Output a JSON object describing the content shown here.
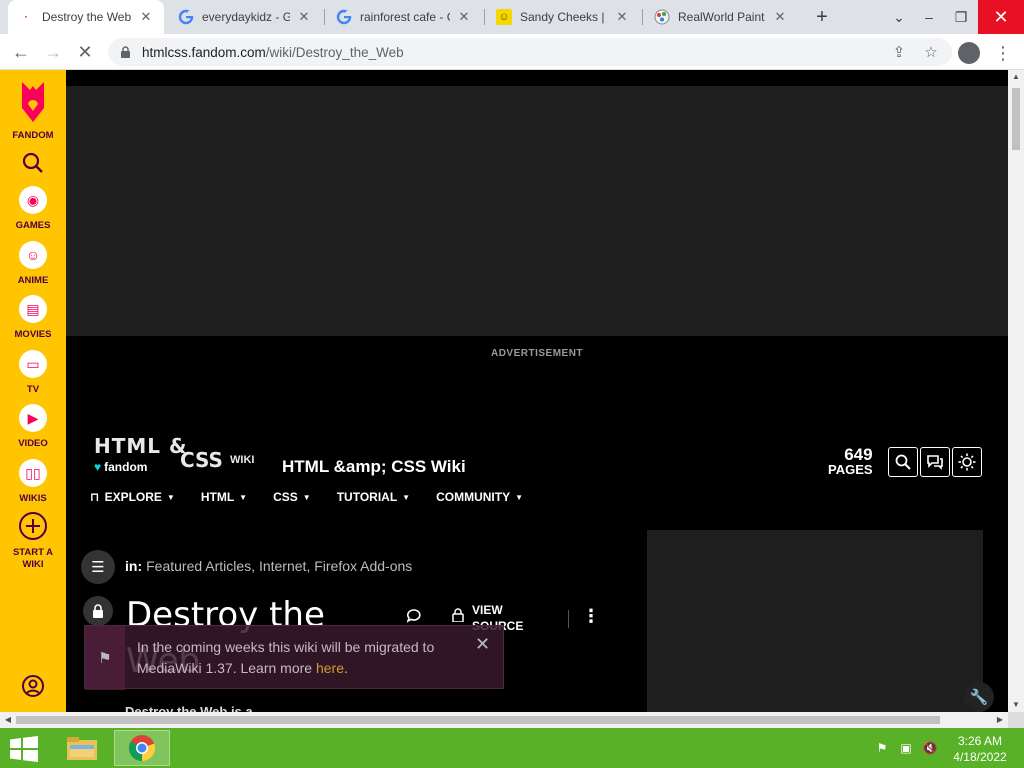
{
  "browser": {
    "tabs": [
      {
        "title": "Destroy the Web",
        "active": true,
        "favicon": "fandom-favicon"
      },
      {
        "title": "everydaykidz - Go",
        "active": false,
        "favicon": "google-favicon"
      },
      {
        "title": "rainforest cafe - G",
        "active": false,
        "favicon": "google-favicon"
      },
      {
        "title": "Sandy Cheeks | Sp",
        "active": false,
        "favicon": "spongebob-favicon"
      },
      {
        "title": "RealWorld Paint -",
        "active": false,
        "favicon": "paint-favicon"
      }
    ],
    "url_host": "htmlcss.fandom.com",
    "url_path": "/wiki/Destroy_the_Web"
  },
  "rail": {
    "items": [
      {
        "label": "FANDOM"
      },
      {
        "label": "GAMES"
      },
      {
        "label": "ANIME"
      },
      {
        "label": "MOVIES"
      },
      {
        "label": "TV"
      },
      {
        "label": "VIDEO"
      },
      {
        "label": "WIKIS"
      },
      {
        "label": "START A WIKI"
      }
    ]
  },
  "page": {
    "ad_label": "ADVERTISEMENT",
    "logo": {
      "line1": "HTML &",
      "line2": "CSS",
      "wiki": "WIKI",
      "fandom": "fandom"
    },
    "wiki_name": "HTML &amp; CSS Wiki",
    "page_count": "649",
    "page_count_label": "PAGES",
    "nav": [
      {
        "label": "EXPLORE"
      },
      {
        "label": "HTML"
      },
      {
        "label": "CSS"
      },
      {
        "label": "TUTORIAL"
      },
      {
        "label": "COMMUNITY"
      }
    ],
    "categories_prefix": "in:",
    "categories": [
      "Featured Articles",
      "Internet",
      "Firefox Add-ons"
    ],
    "title": "Destroy the Web",
    "view_source": "VIEW SOURCE",
    "notice_text": "In the coming weeks this wiki will be migrated to MediaWiki 1.37. Learn more ",
    "notice_link": "here",
    "notice_after": ".",
    "intro_text": "Destroy the Web is a"
  },
  "taskbar": {
    "time": "3:26 AM",
    "date": "4/18/2022"
  },
  "colors": {
    "rail_bg": "#ffc500",
    "fandom_pink": "#fa005a",
    "taskbar": "#58b126"
  }
}
